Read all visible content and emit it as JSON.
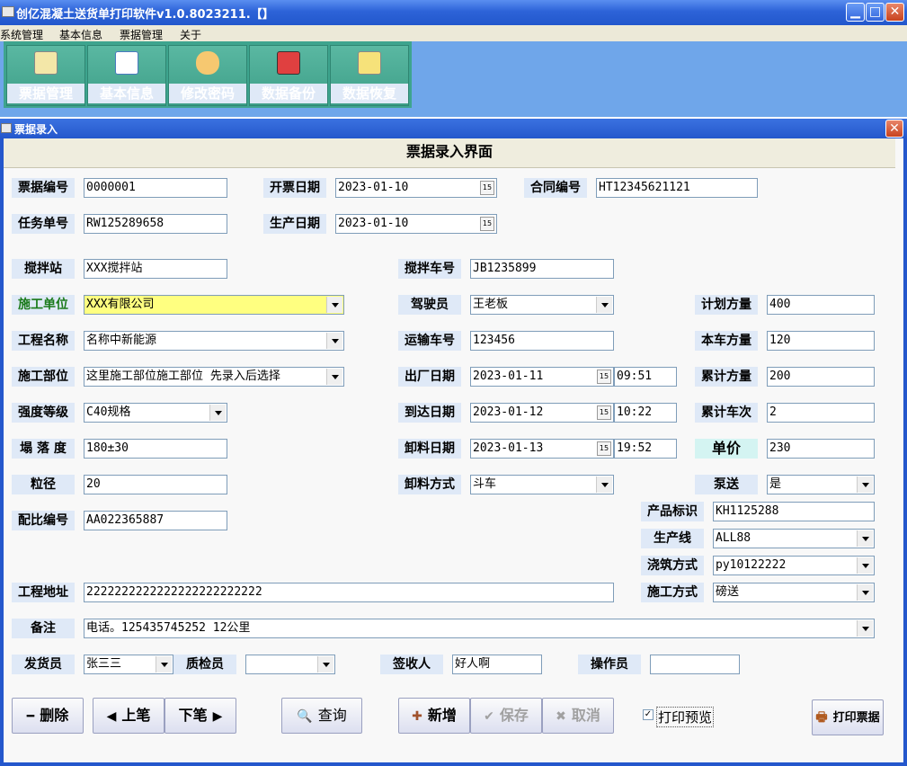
{
  "window": {
    "title": "创亿混凝土送货单打印软件v1.0.8023211.【】",
    "minimize": "▁",
    "maximize": "□",
    "close": "✕"
  },
  "menu": [
    "系统管理",
    "基本信息",
    "票据管理",
    "关于"
  ],
  "toolbar": [
    {
      "label": "票据管理",
      "icon": "edit-notepad-icon"
    },
    {
      "label": "基本信息",
      "icon": "calendar-grid-icon"
    },
    {
      "label": "修改密码",
      "icon": "users-icon"
    },
    {
      "label": "数据备份",
      "icon": "pencil-icon"
    },
    {
      "label": "数据恢复",
      "icon": "pencil-paper-icon"
    }
  ],
  "child": {
    "title": "票据录入",
    "close": "✕",
    "form_title": "票据录入界面"
  },
  "fields": {
    "ticket_no": {
      "label": "票据编号",
      "value": "0000001"
    },
    "issue_date": {
      "label": "开票日期",
      "value": "2023-01-10"
    },
    "contract_no": {
      "label": "合同编号",
      "value": "HT12345621121"
    },
    "task_no": {
      "label": "任务单号",
      "value": "RW125289658"
    },
    "prod_date": {
      "label": "生产日期",
      "value": "2023-01-10"
    },
    "station": {
      "label": "搅拌站",
      "value": "XXX搅拌站"
    },
    "mixer_no": {
      "label": "搅拌车号",
      "value": "JB1235899"
    },
    "builder": {
      "label": "施工单位",
      "value": "XXX有限公司"
    },
    "driver": {
      "label": "驾驶员",
      "value": "王老板"
    },
    "plan_vol": {
      "label": "计划方量",
      "value": "400"
    },
    "project": {
      "label": "工程名称",
      "value": "名称中新能源"
    },
    "truck_no": {
      "label": "运输车号",
      "value": "123456"
    },
    "this_vol": {
      "label": "本车方量",
      "value": "120"
    },
    "part": {
      "label": "施工部位",
      "value": "这里施工部位施工部位 先录入后选择"
    },
    "out_date": {
      "label": "出厂日期",
      "value": "2023-01-11",
      "time": "09:51"
    },
    "total_vol": {
      "label": "累计方量",
      "value": "200"
    },
    "grade": {
      "label": "强度等级",
      "value": "C40规格"
    },
    "arrive_date": {
      "label": "到达日期",
      "value": "2023-01-12",
      "time": "10:22"
    },
    "total_trips": {
      "label": "累计车次",
      "value": "2"
    },
    "slump": {
      "label": "塌 落 度",
      "value": "180±30"
    },
    "unload_date": {
      "label": "卸料日期",
      "value": "2023-01-13",
      "time": "19:52"
    },
    "price": {
      "label": "单价",
      "value": "230"
    },
    "size": {
      "label": "粒径",
      "value": "20"
    },
    "unload_mode": {
      "label": "卸料方式",
      "value": "斗车"
    },
    "pump": {
      "label": "泵送",
      "value": "是"
    },
    "mix_no": {
      "label": "配比编号",
      "value": "AA022365887"
    },
    "product_id": {
      "label": "产品标识",
      "value": "KH1125288"
    },
    "line": {
      "label": "生产线",
      "value": "ALL88"
    },
    "pour": {
      "label": "浇筑方式",
      "value": "py10122222"
    },
    "address": {
      "label": "工程地址",
      "value": "2222222222222222222222222"
    },
    "method": {
      "label": "施工方式",
      "value": "磅送"
    },
    "remark": {
      "label": "备注",
      "value": "电话。125435745252 12公里"
    },
    "sender": {
      "label": "发货员",
      "value": "张三三"
    },
    "inspector": {
      "label": "质检员",
      "value": ""
    },
    "receiver": {
      "label": "签收人",
      "value": "好人啊"
    },
    "operator": {
      "label": "操作员",
      "value": ""
    }
  },
  "calendar_glyph": "15",
  "buttons": {
    "delete": {
      "glyph": "━",
      "label": "删除"
    },
    "prev": {
      "glyph": "◀",
      "label": "上笔"
    },
    "next": {
      "glyph": "▶",
      "label": "下笔"
    },
    "query": {
      "glyph": "🔍",
      "label": "查询"
    },
    "add": {
      "glyph": "✚",
      "label": "新增"
    },
    "save": {
      "glyph": "✔",
      "label": "保存"
    },
    "cancel": {
      "glyph": "✖",
      "label": "取消"
    },
    "print_preview": {
      "label": "打印预览",
      "checked": "✓"
    },
    "print": {
      "glyph": "🖶",
      "label": "打印票据"
    }
  }
}
